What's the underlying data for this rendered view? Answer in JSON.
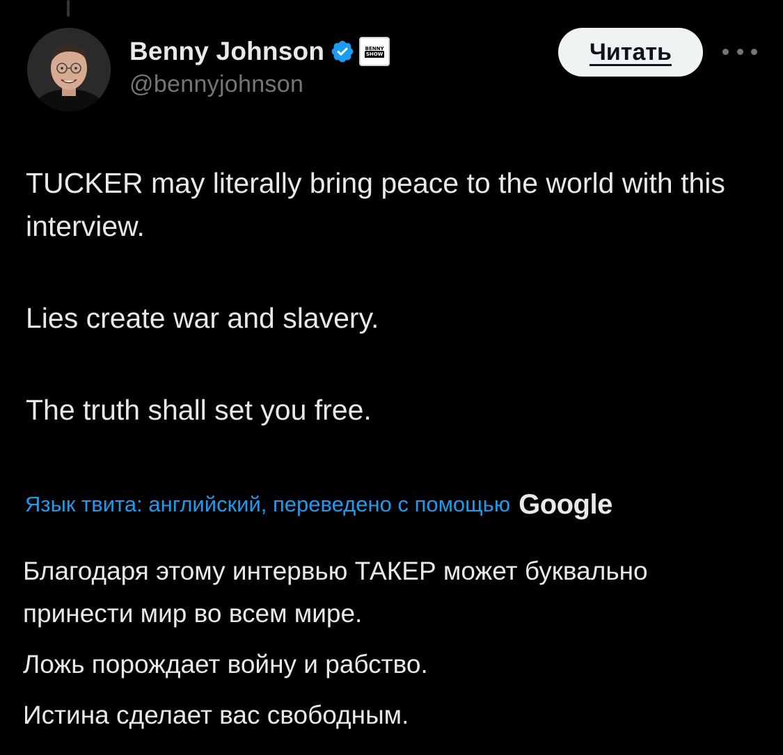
{
  "author": {
    "display_name": "Benny Johnson",
    "handle": "@bennyjohnson",
    "verified_icon": "verified-checkmark-icon",
    "affiliate_badge": {
      "line1": "BENNY",
      "line2": "SHOW"
    }
  },
  "actions": {
    "follow_label": "Читать",
    "more_icon": "more-options-icon"
  },
  "tweet": {
    "paragraphs": [
      "TUCKER may literally bring peace to the world with this interview.",
      "Lies create war and slavery.",
      "The truth shall set you free."
    ]
  },
  "translation": {
    "label": "Язык твита: английский, переведено с помощью",
    "provider": "Google",
    "paragraphs": [
      "Благодаря этому интервью ТАКЕР может буквально принести мир во всем мире.",
      "Ложь порождает войну и рабство.",
      "Истина сделает вас свободным."
    ]
  },
  "colors": {
    "background": "#000000",
    "text_primary": "#e7e9ea",
    "text_secondary": "#71767b",
    "accent": "#1d9bf0",
    "button_bg": "#eff3f4"
  }
}
